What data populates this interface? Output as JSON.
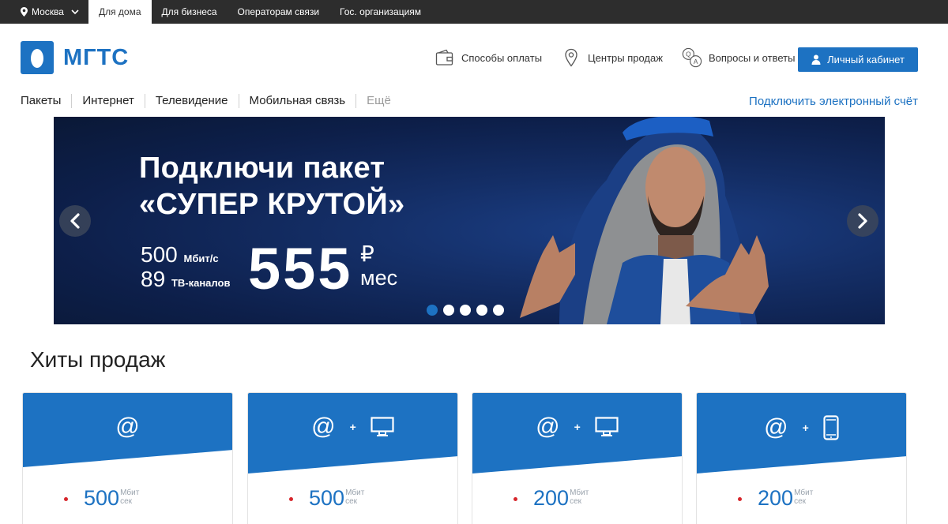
{
  "topbar": {
    "city": "Москва",
    "segments": [
      "Для дома",
      "Для бизнеса",
      "Операторам связи",
      "Гос. организациям"
    ],
    "active_segment": "Для дома"
  },
  "header": {
    "logo_text": "МГТС",
    "links": [
      "Способы оплаты",
      "Центры продаж",
      "Вопросы и ответы"
    ],
    "cabinet_label": "Личный кабинет"
  },
  "nav": {
    "items": [
      "Пакеты",
      "Интернет",
      "Телевидение",
      "Мобильная связь",
      "Ещё"
    ],
    "ebill_label": "Подключить электронный счёт"
  },
  "banner": {
    "title_line1": "Подключи пакет",
    "title_line2": "«СУПЕР КРУТОЙ»",
    "spec1_value": "500",
    "spec1_unit": "Мбит/с",
    "spec2_value": "89",
    "spec2_unit": "ТВ-каналов",
    "price": "555",
    "currency": "₽",
    "period": "мес",
    "slides_total": 5,
    "active_slide": 1
  },
  "hits": {
    "title": "Хиты продаж",
    "cards": [
      {
        "services": [
          "internet"
        ],
        "speed": "500",
        "unit_top": "Мбит",
        "unit_bottom": "сек"
      },
      {
        "services": [
          "internet",
          "tv"
        ],
        "speed": "500",
        "unit_top": "Мбит",
        "unit_bottom": "сек"
      },
      {
        "services": [
          "internet",
          "tv"
        ],
        "speed": "200",
        "unit_top": "Мбит",
        "unit_bottom": "сек"
      },
      {
        "services": [
          "internet",
          "mobile"
        ],
        "speed": "200",
        "unit_top": "Мбит",
        "unit_bottom": "сек"
      }
    ],
    "plus_sign": "+",
    "at_sign": "@"
  },
  "colors": {
    "brand_blue": "#1d72c2",
    "topbar_bg": "#2d2d2d",
    "bullet_red": "#d7262c"
  },
  "icons": [
    "location-pin-icon",
    "chevron-down-icon",
    "wallet-icon",
    "map-pin-icon",
    "qa-bubbles-icon",
    "user-icon",
    "chevron-left-icon",
    "chevron-right-icon",
    "monitor-icon",
    "smartphone-icon"
  ]
}
